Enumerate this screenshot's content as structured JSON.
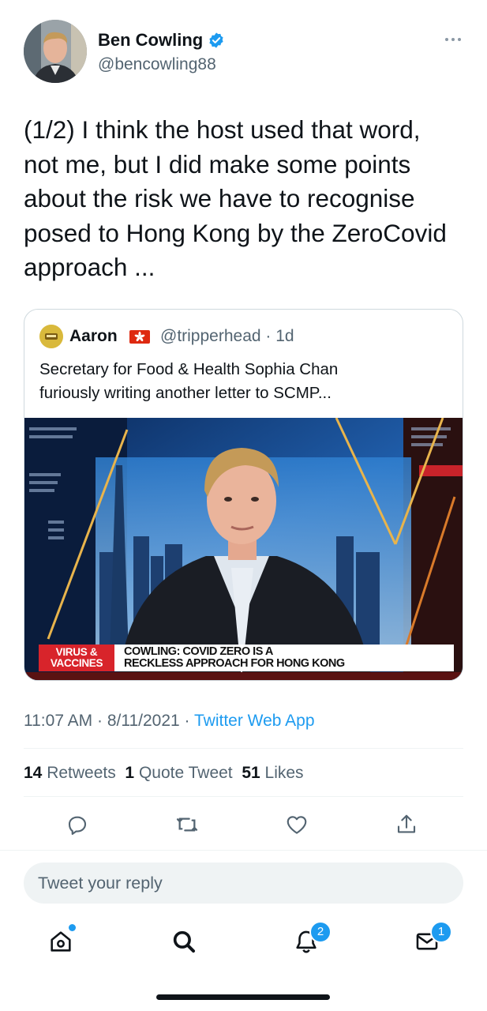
{
  "author": {
    "name": "Ben Cowling",
    "handle": "@bencowling88",
    "verified": true
  },
  "tweet": {
    "lines": [
      "(1/2) I think the host used that word,",
      "not me, but I did make some points",
      "about the risk we have to recognise",
      "posed to Hong Kong by the ZeroCovid",
      "approach ..."
    ]
  },
  "quoted": {
    "name": "Aaron",
    "flag": "hong-kong-flag",
    "handle": "@tripperhead · 1d",
    "lines": [
      "Secretary for Food & Health Sophia Chan",
      "furiously writing another letter to SCMP..."
    ],
    "media": {
      "tag_line1": "VIRUS &",
      "tag_line2": "VACCINES",
      "headline_line1": "COWLING: COVID ZERO IS A",
      "headline_line2": "RECKLESS APPROACH FOR HONG KONG"
    }
  },
  "meta": {
    "time_date": "11:07 AM · 8/11/2021 · ",
    "source": "Twitter Web App"
  },
  "stats": {
    "retweets_count": "14",
    "retweets_label": "Retweets",
    "quotes_count": "1",
    "quotes_label": "Quote Tweet",
    "likes_count": "51",
    "likes_label": "Likes"
  },
  "actions": [
    "reply-icon",
    "retweet-icon",
    "like-icon",
    "share-icon"
  ],
  "reply": {
    "placeholder": "Tweet your reply"
  },
  "nav": {
    "items": [
      "home-icon",
      "search-icon",
      "notifications-icon",
      "messages-icon"
    ],
    "notifications_badge": "2",
    "messages_badge": "1"
  },
  "colors": {
    "accent": "#1d9bf0",
    "text": "#0f1419",
    "secondary": "#536471",
    "border": "#cfd9de",
    "news_red": "#d8242b"
  }
}
